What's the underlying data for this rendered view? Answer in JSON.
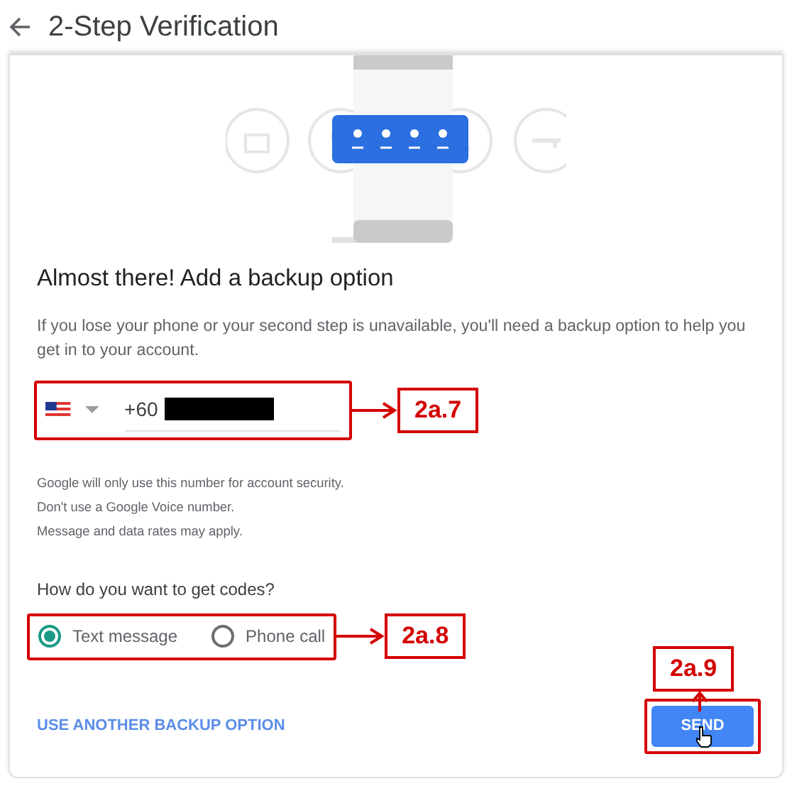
{
  "header": {
    "title": "2-Step Verification"
  },
  "card": {
    "heading": "Almost there! Add a backup option",
    "description": "If you lose your phone or your second step is unavailable, you'll need a backup option to help you get in to your account.",
    "phone": {
      "country_code": "+60"
    },
    "notes": [
      "Google will only use this number for account security.",
      "Don't use a Google Voice number.",
      "Message and data rates may apply."
    ],
    "question": "How do you want to get codes?",
    "options": [
      {
        "label": "Text message",
        "selected": true
      },
      {
        "label": "Phone call",
        "selected": false
      }
    ],
    "link": "USE ANOTHER BACKUP OPTION",
    "button": "SEND"
  },
  "annotations": [
    {
      "label": "2a.7"
    },
    {
      "label": "2a.8"
    },
    {
      "label": "2a.9"
    }
  ]
}
